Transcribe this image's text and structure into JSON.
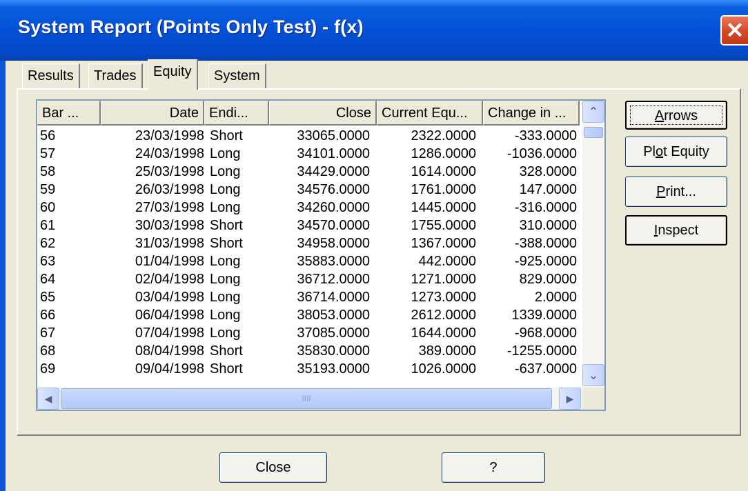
{
  "window": {
    "title": "System Report (Points Only Test)  - f(x)",
    "close_glyph": "✕"
  },
  "tabs": [
    {
      "label": "Results"
    },
    {
      "label": "Trades"
    },
    {
      "label": "Equity",
      "active": true
    },
    {
      "label": "System"
    }
  ],
  "table": {
    "columns": [
      "Bar ...",
      "Date",
      "Endi...",
      "Close",
      "Current Equ...",
      "Change in ..."
    ],
    "rows": [
      [
        "56",
        "23/03/1998",
        "Short",
        "33065.0000",
        "2322.0000",
        "-333.0000"
      ],
      [
        "57",
        "24/03/1998",
        "Long",
        "34101.0000",
        "1286.0000",
        "-1036.0000"
      ],
      [
        "58",
        "25/03/1998",
        "Long",
        "34429.0000",
        "1614.0000",
        "328.0000"
      ],
      [
        "59",
        "26/03/1998",
        "Long",
        "34576.0000",
        "1761.0000",
        "147.0000"
      ],
      [
        "60",
        "27/03/1998",
        "Long",
        "34260.0000",
        "1445.0000",
        "-316.0000"
      ],
      [
        "61",
        "30/03/1998",
        "Short",
        "34570.0000",
        "1755.0000",
        "310.0000"
      ],
      [
        "62",
        "31/03/1998",
        "Short",
        "34958.0000",
        "1367.0000",
        "-388.0000"
      ],
      [
        "63",
        "01/04/1998",
        "Long",
        "35883.0000",
        "442.0000",
        "-925.0000"
      ],
      [
        "64",
        "02/04/1998",
        "Long",
        "36712.0000",
        "1271.0000",
        "829.0000"
      ],
      [
        "65",
        "03/04/1998",
        "Long",
        "36714.0000",
        "1273.0000",
        "2.0000"
      ],
      [
        "66",
        "06/04/1998",
        "Long",
        "38053.0000",
        "2612.0000",
        "1339.0000"
      ],
      [
        "67",
        "07/04/1998",
        "Long",
        "37085.0000",
        "1644.0000",
        "-968.0000"
      ],
      [
        "68",
        "08/04/1998",
        "Short",
        "35830.0000",
        "389.0000",
        "-1255.0000"
      ],
      [
        "69",
        "09/04/1998",
        "Short",
        "35193.0000",
        "1026.0000",
        "-637.0000"
      ]
    ]
  },
  "scroll": {
    "up_glyph": "⌃",
    "down_glyph": "⌄",
    "left_glyph": "◀",
    "right_glyph": "▶",
    "grip": "IIII"
  },
  "side_buttons": {
    "arrows": {
      "prefix": "",
      "accel": "A",
      "rest": "rrows"
    },
    "plot_equity": {
      "prefix": "Pl",
      "accel": "o",
      "rest": "t Equity"
    },
    "print": {
      "prefix": "",
      "accel": "P",
      "rest": "rint..."
    },
    "inspect": {
      "prefix": "",
      "accel": "I",
      "rest": "nspect"
    }
  },
  "bottom_buttons": {
    "close": "Close",
    "help": "?"
  }
}
